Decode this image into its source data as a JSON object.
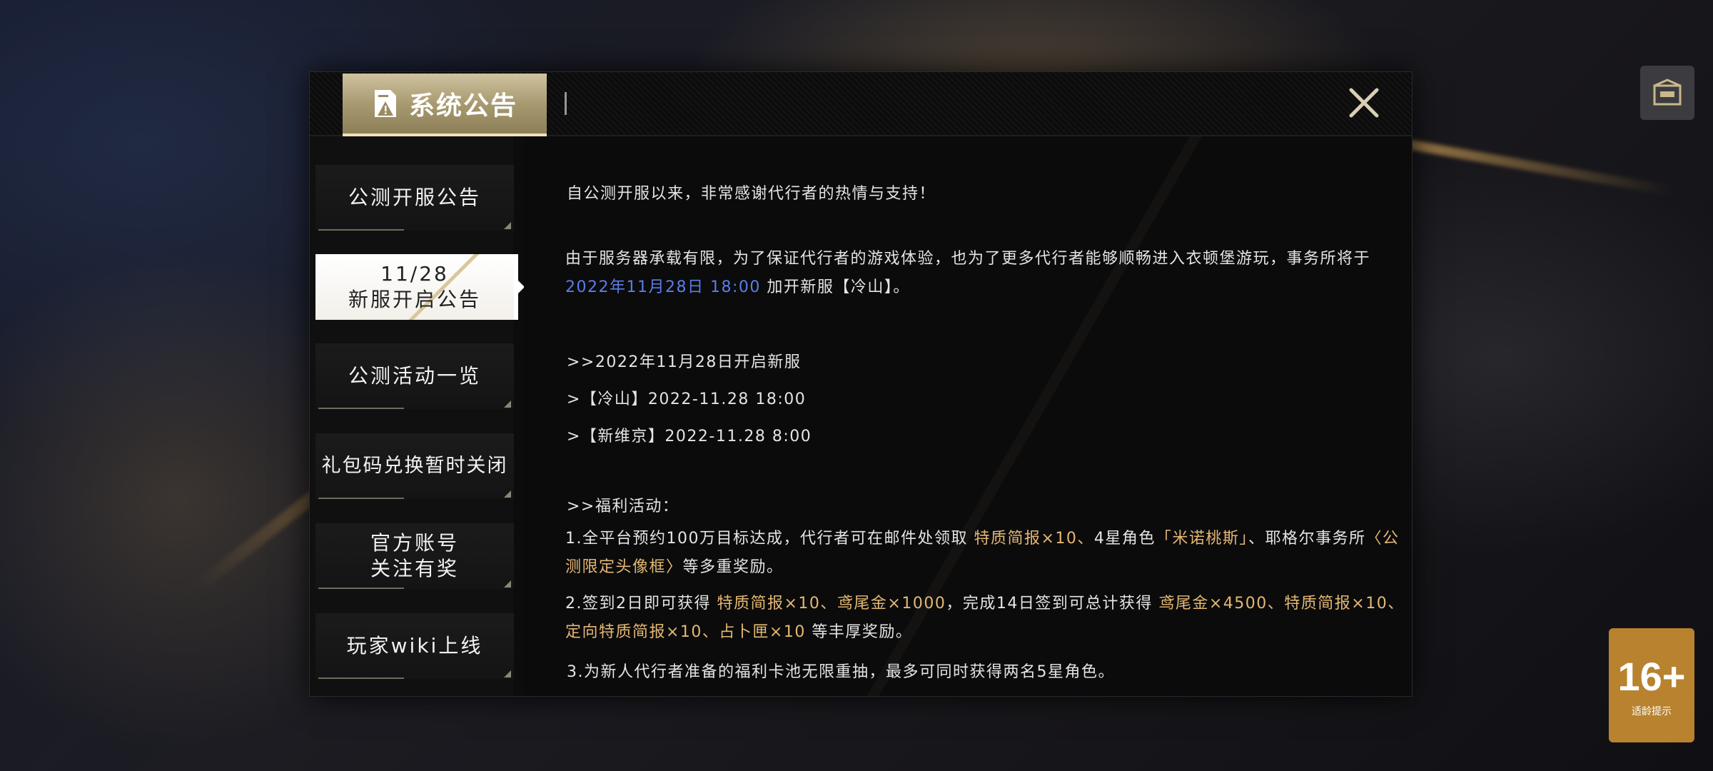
{
  "dialog": {
    "tab_title": "系统公告",
    "close_icon": "close-icon"
  },
  "sidebar": {
    "items": [
      {
        "label": "公测开服公告"
      },
      {
        "label_line1": "11/28",
        "label_line2": "新服开启公告",
        "active": true
      },
      {
        "label": "公测活动一览"
      },
      {
        "label": "礼包码兑换暂时关闭"
      },
      {
        "label_line1": "官方账号",
        "label_line2": "关注有奖"
      },
      {
        "label": "玩家wiki上线"
      }
    ]
  },
  "content": {
    "intro": "自公测开服以来，非常感谢代行者的热情与支持！",
    "para1_a": "由于服务器承载有限，为了保证代行者的游戏体验，也为了更多代行者能够顺畅进入衣顿堡游玩，事务所将于 ",
    "para1_date": "2022年11月28日 18:00",
    "para1_b": " 加开新服【冷山】。",
    "open_heading": ">>2022年11月28日开启新服",
    "open_line1": ">【冷山】2022-11.28 18:00",
    "open_line2": ">【新维京】2022-11.28 8:00",
    "welfare_heading": ">>福利活动：",
    "w1_a": "1.全平台预约100万目标达成，代行者可在邮件处领取 ",
    "w1_h1": "特质简报×10、",
    "w1_b": "4星角色",
    "w1_h2": "「米诺桃斯」",
    "w1_c": "、耶格尔事务所",
    "w1_h3": "〈公测限定头像框〉",
    "w1_d": "等多重奖励。",
    "w2_a": "2.签到2日即可获得 ",
    "w2_h1": "特质简报×10、鸢尾金×1000",
    "w2_b": "，完成14日签到可总计获得 ",
    "w2_h2": "鸢尾金×4500、特质简报×10、定向特质简报×10、占卜匣×10",
    "w2_c": " 等丰厚奖励。",
    "w3": "3.为新人代行者准备的福利卡池无限重抽，最多可同时获得两名5星角色。"
  },
  "overlay": {
    "age_rating": "16+",
    "age_sub": "适龄提示"
  },
  "colors": {
    "accent_gold": "#e4b873",
    "accent_blue": "#5b7ee6",
    "tab_gold": "#a89a70"
  }
}
